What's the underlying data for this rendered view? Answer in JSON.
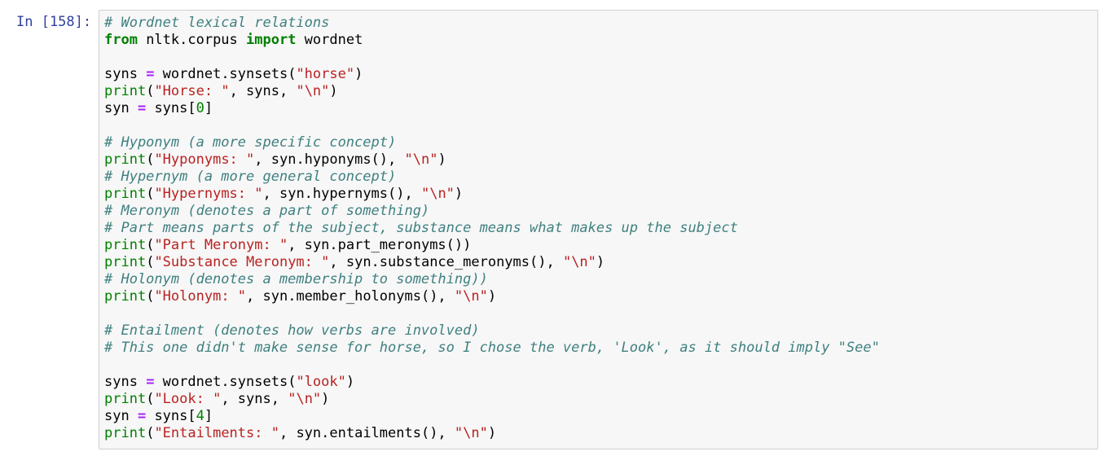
{
  "cell": {
    "prompt": "In [158]:",
    "lines": [
      [
        {
          "t": "c",
          "v": "# Wordnet lexical relations"
        }
      ],
      [
        {
          "t": "k",
          "v": "from"
        },
        {
          "t": "n",
          "v": " nltk.corpus "
        },
        {
          "t": "k",
          "v": "import"
        },
        {
          "t": "n",
          "v": " wordnet"
        }
      ],
      [],
      [
        {
          "t": "n",
          "v": "syns "
        },
        {
          "t": "o",
          "v": "="
        },
        {
          "t": "n",
          "v": " wordnet.synsets("
        },
        {
          "t": "s",
          "v": "\"horse\""
        },
        {
          "t": "n",
          "v": ")"
        }
      ],
      [
        {
          "t": "b",
          "v": "print"
        },
        {
          "t": "n",
          "v": "("
        },
        {
          "t": "s",
          "v": "\"Horse: \""
        },
        {
          "t": "n",
          "v": ", syns, "
        },
        {
          "t": "s",
          "v": "\"\\n\""
        },
        {
          "t": "n",
          "v": ")"
        }
      ],
      [
        {
          "t": "n",
          "v": "syn "
        },
        {
          "t": "o",
          "v": "="
        },
        {
          "t": "n",
          "v": " syns["
        },
        {
          "t": "m",
          "v": "0"
        },
        {
          "t": "n",
          "v": "]"
        }
      ],
      [],
      [
        {
          "t": "c",
          "v": "# Hyponym (a more specific concept)"
        }
      ],
      [
        {
          "t": "b",
          "v": "print"
        },
        {
          "t": "n",
          "v": "("
        },
        {
          "t": "s",
          "v": "\"Hyponyms: \""
        },
        {
          "t": "n",
          "v": ", syn.hyponyms(), "
        },
        {
          "t": "s",
          "v": "\"\\n\""
        },
        {
          "t": "n",
          "v": ")"
        }
      ],
      [
        {
          "t": "c",
          "v": "# Hypernym (a more general concept)"
        }
      ],
      [
        {
          "t": "b",
          "v": "print"
        },
        {
          "t": "n",
          "v": "("
        },
        {
          "t": "s",
          "v": "\"Hypernyms: \""
        },
        {
          "t": "n",
          "v": ", syn.hypernyms(), "
        },
        {
          "t": "s",
          "v": "\"\\n\""
        },
        {
          "t": "n",
          "v": ")"
        }
      ],
      [
        {
          "t": "c",
          "v": "# Meronym (denotes a part of something)"
        }
      ],
      [
        {
          "t": "c",
          "v": "# Part means parts of the subject, substance means what makes up the subject"
        }
      ],
      [
        {
          "t": "b",
          "v": "print"
        },
        {
          "t": "n",
          "v": "("
        },
        {
          "t": "s",
          "v": "\"Part Meronym: \""
        },
        {
          "t": "n",
          "v": ", syn.part_meronyms())"
        }
      ],
      [
        {
          "t": "b",
          "v": "print"
        },
        {
          "t": "n",
          "v": "("
        },
        {
          "t": "s",
          "v": "\"Substance Meronym: \""
        },
        {
          "t": "n",
          "v": ", syn.substance_meronyms(), "
        },
        {
          "t": "s",
          "v": "\"\\n\""
        },
        {
          "t": "n",
          "v": ")"
        }
      ],
      [
        {
          "t": "c",
          "v": "# Holonym (denotes a membership to something))"
        }
      ],
      [
        {
          "t": "b",
          "v": "print"
        },
        {
          "t": "n",
          "v": "("
        },
        {
          "t": "s",
          "v": "\"Holonym: \""
        },
        {
          "t": "n",
          "v": ", syn.member_holonyms(), "
        },
        {
          "t": "s",
          "v": "\"\\n\""
        },
        {
          "t": "n",
          "v": ")"
        }
      ],
      [],
      [
        {
          "t": "c",
          "v": "# Entailment (denotes how verbs are involved)"
        }
      ],
      [
        {
          "t": "c",
          "v": "# This one didn't make sense for horse, so I chose the verb, 'Look', as it should imply \"See\""
        }
      ],
      [],
      [
        {
          "t": "n",
          "v": "syns "
        },
        {
          "t": "o",
          "v": "="
        },
        {
          "t": "n",
          "v": " wordnet.synsets("
        },
        {
          "t": "s",
          "v": "\"look\""
        },
        {
          "t": "n",
          "v": ")"
        }
      ],
      [
        {
          "t": "b",
          "v": "print"
        },
        {
          "t": "n",
          "v": "("
        },
        {
          "t": "s",
          "v": "\"Look: \""
        },
        {
          "t": "n",
          "v": ", syns, "
        },
        {
          "t": "s",
          "v": "\"\\n\""
        },
        {
          "t": "n",
          "v": ")"
        }
      ],
      [
        {
          "t": "n",
          "v": "syn "
        },
        {
          "t": "o",
          "v": "="
        },
        {
          "t": "n",
          "v": " syns["
        },
        {
          "t": "m",
          "v": "4"
        },
        {
          "t": "n",
          "v": "]"
        }
      ],
      [
        {
          "t": "b",
          "v": "print"
        },
        {
          "t": "n",
          "v": "("
        },
        {
          "t": "s",
          "v": "\"Entailments: \""
        },
        {
          "t": "n",
          "v": ", syn.entailments(), "
        },
        {
          "t": "s",
          "v": "\"\\n\""
        },
        {
          "t": "n",
          "v": ")"
        }
      ]
    ]
  }
}
